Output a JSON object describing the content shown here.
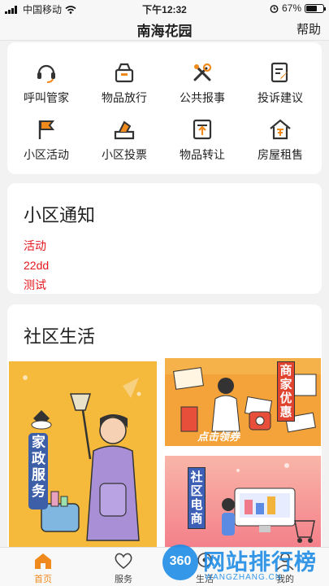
{
  "status": {
    "carrier": "中国移动",
    "time": "下午12:32",
    "battery": "67%",
    "battery_level": 0.67
  },
  "header": {
    "title": "南海花园",
    "help_label": "帮助"
  },
  "services": [
    {
      "label": "呼叫管家",
      "icon": "headset-icon"
    },
    {
      "label": "物品放行",
      "icon": "box-release-icon"
    },
    {
      "label": "公共报事",
      "icon": "tools-icon"
    },
    {
      "label": "投诉建议",
      "icon": "edit-note-icon"
    },
    {
      "label": "小区活动",
      "icon": "flag-icon"
    },
    {
      "label": "小区投票",
      "icon": "vote-box-icon"
    },
    {
      "label": "物品转让",
      "icon": "transfer-icon"
    },
    {
      "label": "房屋租售",
      "icon": "house-icon"
    }
  ],
  "notice": {
    "title": "小区通知",
    "items": [
      "活动",
      "22dd",
      "测试"
    ]
  },
  "life": {
    "title": "社区生活",
    "banners": [
      {
        "label": "家政服务"
      },
      {
        "label": "商家优惠",
        "subtitle": "点击领券"
      },
      {
        "label": "社区电商"
      }
    ]
  },
  "tabs": [
    {
      "label": "首页",
      "icon": "home-icon"
    },
    {
      "label": "服务",
      "icon": "heart-icon"
    },
    {
      "label": "生活",
      "icon": "life-icon"
    },
    {
      "label": "我的",
      "icon": "user-icon"
    }
  ],
  "watermark": {
    "brand": "360",
    "text": "网站排行榜",
    "url": "WANGZHANG.CN"
  },
  "colors": {
    "accent": "#f08a1c",
    "notice_red": "#e4171e",
    "banner_yellow": "#f5b93c",
    "banner_orange": "#f4a23a",
    "banner_pink": "#f47f8a"
  }
}
